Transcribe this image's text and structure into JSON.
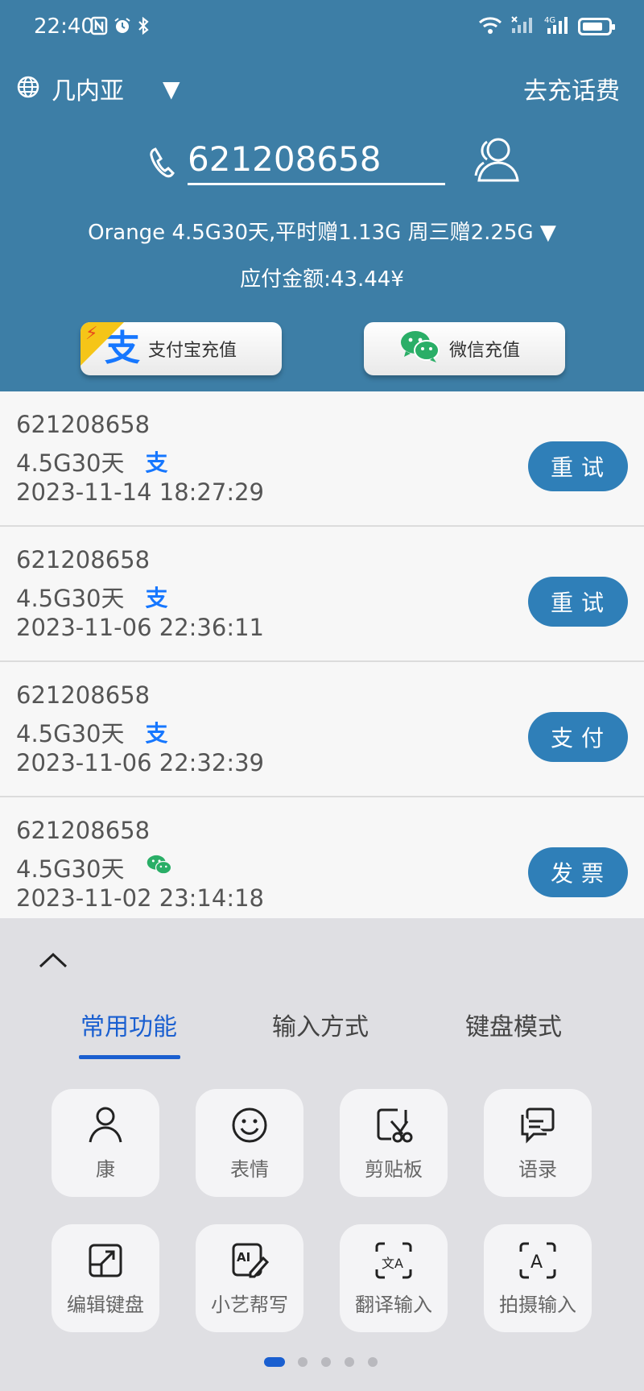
{
  "statusbar": {
    "time": "22:40",
    "left_icons": [
      "nfc-icon",
      "alarm-icon",
      "bluetooth-icon"
    ],
    "right_icons": [
      "wifi-icon",
      "signal-1-icon",
      "signal-2-icon",
      "battery-icon"
    ],
    "network": "4G"
  },
  "header": {
    "country": "几内亚",
    "country_caret": "▼",
    "top_right": "去充话费",
    "phone_value": "621208658",
    "plan_line": "Orange 4.5G30天,平时赠1.13G 周三赠2.25G ▼",
    "amount_line": "应付金额:43.44¥",
    "alipay_label": "支付宝充值",
    "wechat_label": "微信充值",
    "alipay_glyph": "支",
    "bolt_glyph": "⚡"
  },
  "list": {
    "rows": [
      {
        "number": "621208658",
        "plan": "4.5G30天",
        "pay": "alipay",
        "date": "2023-11-14 18:27:29",
        "action": "重试"
      },
      {
        "number": "621208658",
        "plan": "4.5G30天",
        "pay": "alipay",
        "date": "2023-11-06 22:36:11",
        "action": "重试"
      },
      {
        "number": "621208658",
        "plan": "4.5G30天",
        "pay": "alipay",
        "date": "2023-11-06 22:32:39",
        "action": "支付"
      },
      {
        "number": "621208658",
        "plan": "4.5G30天",
        "pay": "wechat",
        "date": "2023-11-02 23:14:18",
        "action": "发票"
      }
    ],
    "alipay_glyph": "支"
  },
  "panel": {
    "tabs": [
      "常用功能",
      "输入方式",
      "键盘模式"
    ],
    "active_tab": 0,
    "tiles": [
      {
        "label": "康",
        "icon": "person-icon"
      },
      {
        "label": "表情",
        "icon": "smiley-icon"
      },
      {
        "label": "剪贴板",
        "icon": "clipboard-icon"
      },
      {
        "label": "语录",
        "icon": "quotes-icon"
      },
      {
        "label": "编辑键盘",
        "icon": "edit-keyboard-icon"
      },
      {
        "label": "小艺帮写",
        "icon": "ai-write-icon"
      },
      {
        "label": "翻译输入",
        "icon": "translate-icon"
      },
      {
        "label": "拍摄输入",
        "icon": "camera-text-icon"
      }
    ],
    "tile_icon_ai_text": "AI",
    "tile_icon_translate_text": "文A",
    "tile_icon_camera_text": "A",
    "page_dots": 5,
    "active_dot": 0
  },
  "colors": {
    "header_bg": "#3d7ea6",
    "action_button": "#2f7fb8",
    "accent_blue": "#1a5fd0",
    "alipay_blue": "#1677ff",
    "wechat_green": "#2aae67"
  }
}
